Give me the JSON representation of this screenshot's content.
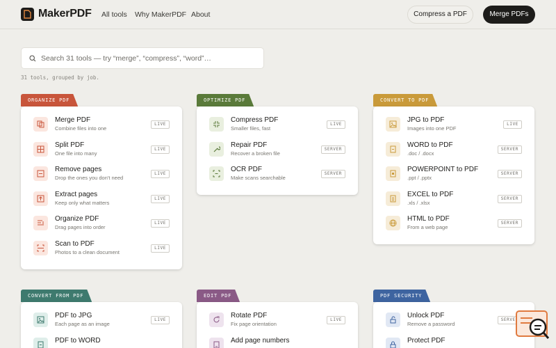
{
  "brand": {
    "name": "MakerPDF"
  },
  "nav": {
    "all_tools": "All tools",
    "why": "Why MakerPDF",
    "about": "About"
  },
  "actions": {
    "compress": "Compress a PDF",
    "merge": "Merge PDFs"
  },
  "search": {
    "placeholder": "Search 31 tools — try “merge”, “compress”, “word”…"
  },
  "summary": "31 tools, grouped by job.",
  "colors": {
    "organize": "#c8553b",
    "optimize": "#5a7a3a",
    "convert_to": "#c99a3a",
    "convert_from": "#3e7a6e",
    "edit": "#8a5a86",
    "security": "#3e64a0"
  },
  "groups": [
    {
      "title": "ORGANIZE PDF",
      "tools": [
        {
          "name": "Merge PDF",
          "desc": "Combine files into one",
          "badge": "LIVE",
          "icon": "merge-icon"
        },
        {
          "name": "Split PDF",
          "desc": "One file into many",
          "badge": "LIVE",
          "icon": "split-icon"
        },
        {
          "name": "Remove pages",
          "desc": "Drop the ones you don't need",
          "badge": "LIVE",
          "icon": "remove-icon"
        },
        {
          "name": "Extract pages",
          "desc": "Keep only what matters",
          "badge": "LIVE",
          "icon": "extract-icon"
        },
        {
          "name": "Organize PDF",
          "desc": "Drag pages into order",
          "badge": "LIVE",
          "icon": "organize-icon"
        },
        {
          "name": "Scan to PDF",
          "desc": "Photos to a clean document",
          "badge": "LIVE",
          "icon": "scan-icon"
        }
      ]
    },
    {
      "title": "OPTIMIZE PDF",
      "tools": [
        {
          "name": "Compress PDF",
          "desc": "Smaller files, fast",
          "badge": "LIVE",
          "icon": "compress-icon"
        },
        {
          "name": "Repair PDF",
          "desc": "Recover a broken file",
          "badge": "SERVER",
          "icon": "wrench-icon"
        },
        {
          "name": "OCR PDF",
          "desc": "Make scans searchable",
          "badge": "SERVER",
          "icon": "ocr-icon"
        }
      ]
    },
    {
      "title": "CONVERT TO PDF",
      "tools": [
        {
          "name": "JPG to PDF",
          "desc": "Images into one PDF",
          "badge": "LIVE",
          "icon": "image-icon"
        },
        {
          "name": "WORD to PDF",
          "desc": ".doc / .docx",
          "badge": "SERVER",
          "icon": "doc-icon"
        },
        {
          "name": "POWERPOINT to PDF",
          "desc": ".ppt / .pptx",
          "badge": "SERVER",
          "icon": "slides-icon"
        },
        {
          "name": "EXCEL to PDF",
          "desc": ".xls / .xlsx",
          "badge": "SERVER",
          "icon": "sheet-icon"
        },
        {
          "name": "HTML to PDF",
          "desc": "From a web page",
          "badge": "SERVER",
          "icon": "globe-icon"
        }
      ]
    },
    {
      "title": "CONVERT FROM PDF",
      "tools": [
        {
          "name": "PDF to JPG",
          "desc": "Each page as an image",
          "badge": "LIVE",
          "icon": "image-icon"
        },
        {
          "name": "PDF to WORD",
          "desc": "",
          "badge": "",
          "icon": "doc-icon"
        }
      ]
    },
    {
      "title": "EDIT PDF",
      "tools": [
        {
          "name": "Rotate PDF",
          "desc": "Fix page orientation",
          "badge": "LIVE",
          "icon": "rotate-icon"
        },
        {
          "name": "Add page numbers",
          "desc": "",
          "badge": "",
          "icon": "numbers-icon"
        }
      ]
    },
    {
      "title": "PDF SECURITY",
      "tools": [
        {
          "name": "Unlock PDF",
          "desc": "Remove a password",
          "badge": "SERVER",
          "icon": "unlock-icon"
        },
        {
          "name": "Protect PDF",
          "desc": "",
          "badge": "",
          "icon": "lock-icon"
        }
      ]
    }
  ]
}
